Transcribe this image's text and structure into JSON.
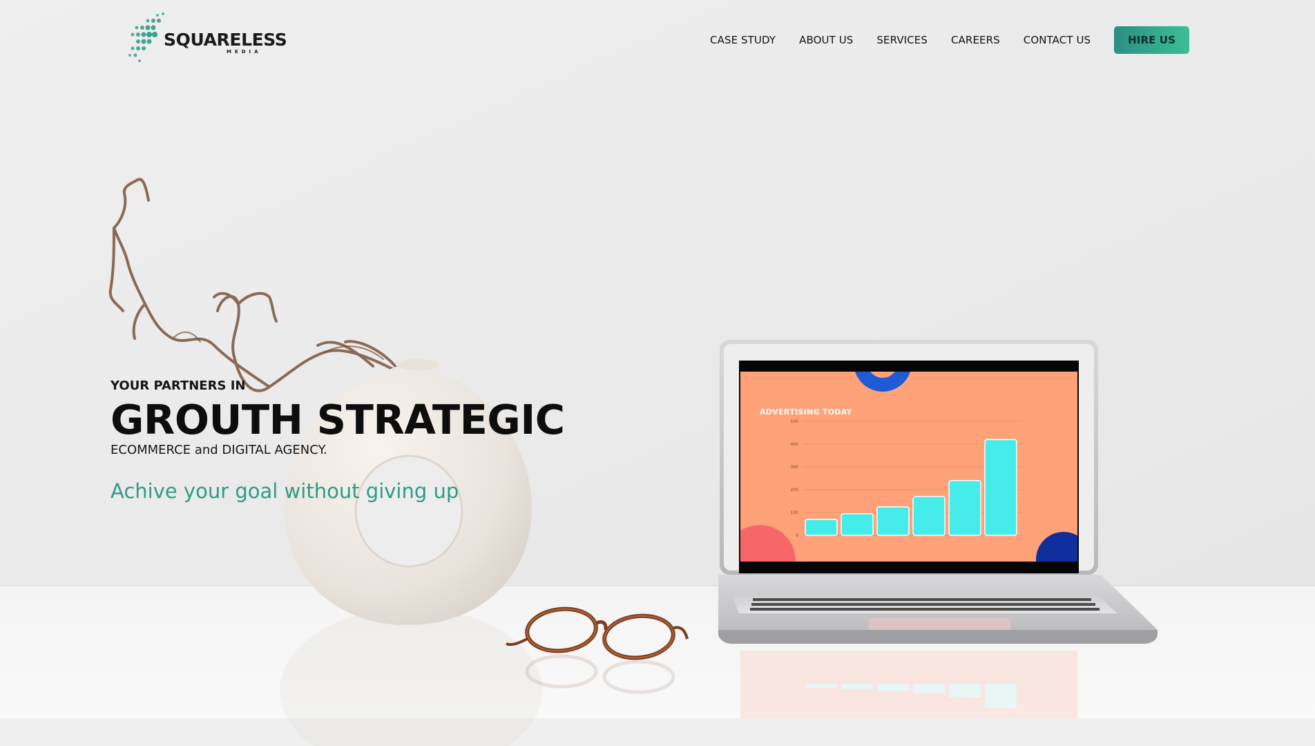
{
  "brand": {
    "name": "SQUARELESS",
    "sub": "MEDIA",
    "accent": "#2e9b86"
  },
  "nav": {
    "items": [
      {
        "label": "CASE STUDY"
      },
      {
        "label": "ABOUT US"
      },
      {
        "label": "SERVICES"
      },
      {
        "label": "CAREERS"
      },
      {
        "label": "CONTACT US"
      }
    ],
    "cta": "HIRE US"
  },
  "hero": {
    "eyebrow": "YOUR PARTNERS IN",
    "headline": "GROUTH STRATEGIC",
    "subline": "ECOMMERCE and DIGITAL AGENCY.",
    "tagline": "Achive your goal without giving up"
  },
  "laptop_screen": {
    "title": "ADVERTISING TODAY",
    "y_ticks": [
      "500",
      "400",
      "300",
      "200",
      "100",
      "0"
    ],
    "bars": [
      70,
      95,
      125,
      170,
      240,
      420
    ],
    "ymax": 500,
    "bar_color": "#45ecea",
    "bg_color": "#ffa27a"
  }
}
